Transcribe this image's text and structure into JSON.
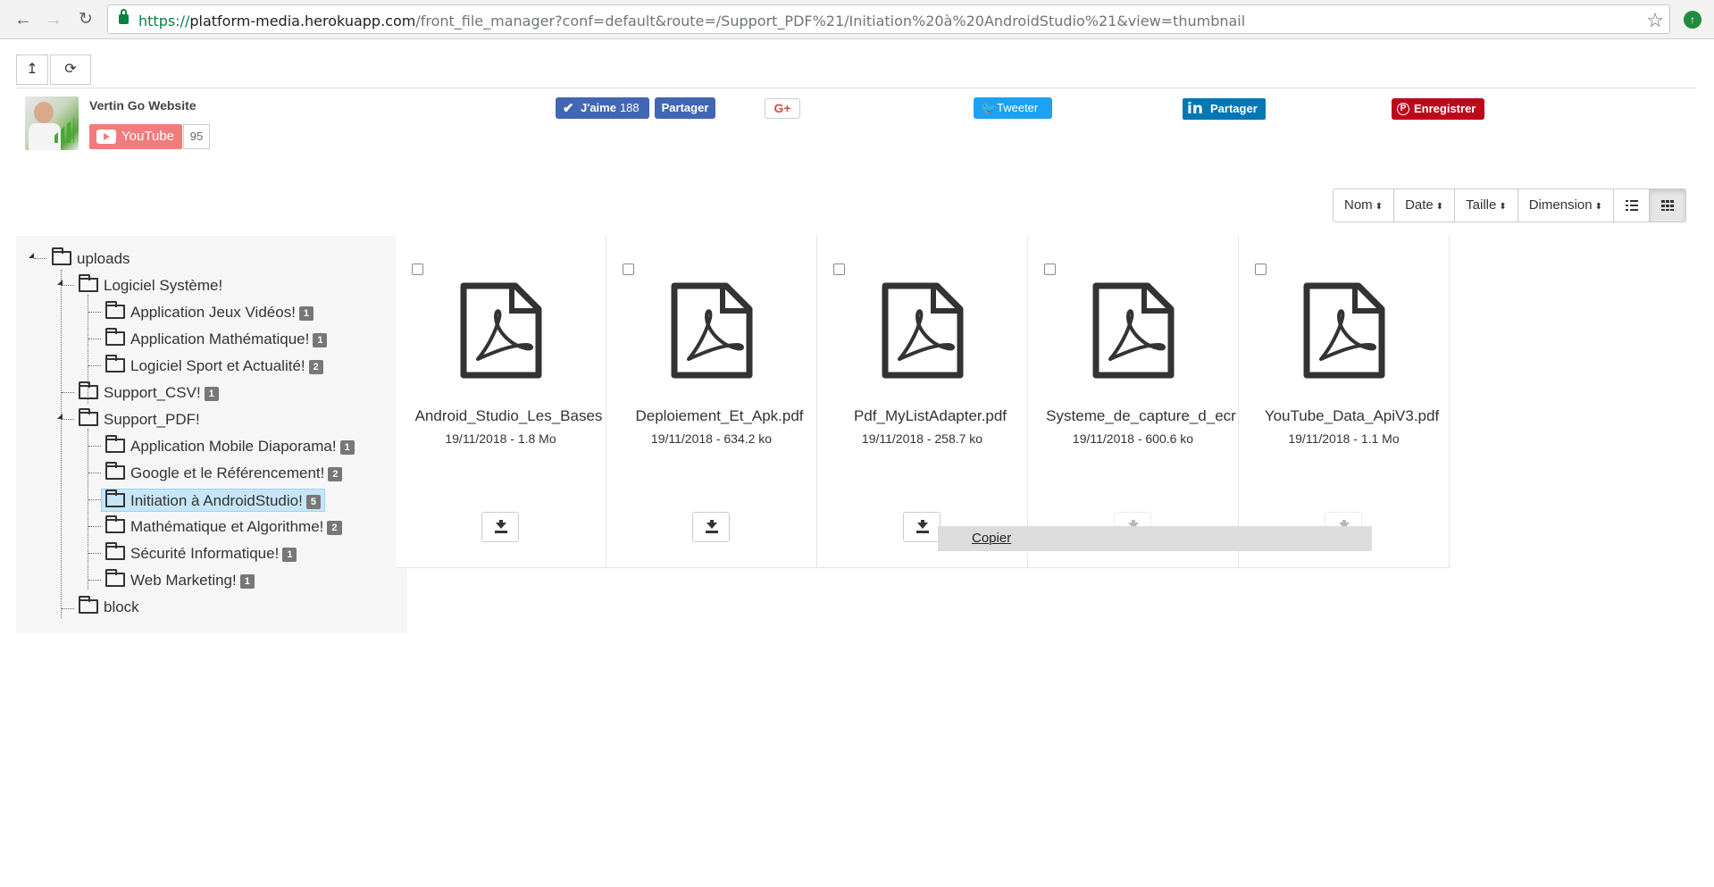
{
  "browser": {
    "url_scheme": "https://",
    "url_host": "platform-media.herokuapp.com",
    "url_path": "/front_file_manager?conf=default&route=/Support_PDF%21/Initiation%20à%20AndroidStudio%21&view=thumbnail"
  },
  "toolbar": {
    "up_icon": "↥",
    "refresh_icon": "⟳"
  },
  "social": {
    "channel_name": "Vertin Go Website",
    "youtube_label": "YouTube",
    "youtube_count": "95",
    "fb_like_label": "J'aime",
    "fb_like_count": "188",
    "fb_share_label": "Partager",
    "gplus_label": "G+",
    "tweet_label": "Tweeter",
    "linkedin_label": "Partager",
    "pinterest_label": "Enregistrer"
  },
  "sort": {
    "name": "Nom",
    "date": "Date",
    "size": "Taille",
    "dimension": "Dimension",
    "caret": "⬍"
  },
  "tree": {
    "root": "uploads",
    "logiciel": "Logiciel Système!",
    "jeux": "Application Jeux Vidéos!",
    "jeux_count": "1",
    "math_app": "Application Mathématique!",
    "math_app_count": "1",
    "sport": "Logiciel Sport et Actualité!",
    "sport_count": "2",
    "csv": "Support_CSV!",
    "csv_count": "1",
    "pdf": "Support_PDF!",
    "diaporama": "Application Mobile Diaporama!",
    "diaporama_count": "1",
    "google": "Google et le Référencement!",
    "google_count": "2",
    "android": "Initiation à AndroidStudio!",
    "android_count": "5",
    "algo": "Mathématique et Algorithme!",
    "algo_count": "2",
    "secu": "Sécurité Informatique!",
    "secu_count": "1",
    "web": "Web Marketing!",
    "web_count": "1",
    "block": "block"
  },
  "files": [
    {
      "name": "Android_Studio_Les_Bases",
      "meta": "19/11/2018 - 1.8 Mo"
    },
    {
      "name": "Deploiement_Et_Apk.pdf",
      "meta": "19/11/2018 - 634.2 ko"
    },
    {
      "name": "Pdf_MyListAdapter.pdf",
      "meta": "19/11/2018 - 258.7 ko"
    },
    {
      "name": "Systeme_de_capture_d_ecr",
      "meta": "19/11/2018 - 600.6 ko"
    },
    {
      "name": "YouTube_Data_ApiV3.pdf",
      "meta": "19/11/2018 - 1.1 Mo"
    }
  ],
  "context_menu": {
    "copy": "Copier"
  },
  "colors": {
    "selected_bg": "#c6e6f7",
    "facebook": "#4267b2",
    "twitter": "#1da1f2",
    "linkedin": "#0077b5",
    "pinterest": "#bd081c",
    "youtube": "#f07c7c"
  }
}
